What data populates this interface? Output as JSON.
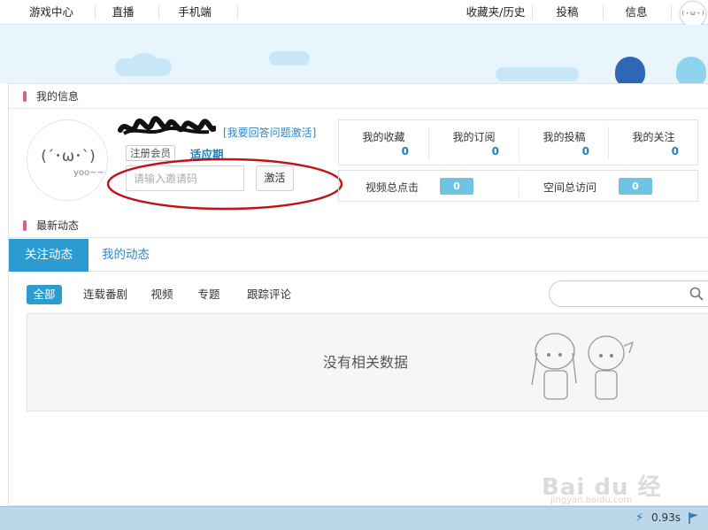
{
  "nav": {
    "game_center": "游戏中心",
    "live": "直播",
    "mobile": "手机端",
    "favorites": "收藏夹/历史",
    "submit": "投稿",
    "messages": "信息"
  },
  "profile_section": {
    "title": "我的信息"
  },
  "user": {
    "avatar_face": "(´･ω･`)",
    "avatar_caption": "yoo~~",
    "activate_link": "[我要回答问题激活]",
    "member_type": "注册会员",
    "status": "适应期",
    "invite_placeholder": "请输入邀请码",
    "activate_button": "激活"
  },
  "stats": {
    "favorites_label": "我的收藏",
    "favorites_value": "0",
    "subscriptions_label": "我的订阅",
    "subscriptions_value": "0",
    "submissions_label": "我的投稿",
    "submissions_value": "0",
    "following_label": "我的关注",
    "following_value": "0"
  },
  "totals": {
    "video_clicks_label": "视频总点击",
    "video_clicks_value": "0",
    "space_visits_label": "空间总访问",
    "space_visits_value": "0"
  },
  "feed_section": {
    "title": "最新动态"
  },
  "tabs": {
    "following": "关注动态",
    "mine": "我的动态"
  },
  "filters": {
    "all": "全部",
    "series": "连载番剧",
    "video": "视频",
    "topic": "专题",
    "comments": "跟踪评论"
  },
  "empty": {
    "message": "没有相关数据"
  },
  "watermark": {
    "text": "Bai du 经验",
    "url": "jingyan.baidu.com"
  },
  "statusbar": {
    "time": "0.93s"
  },
  "colors": {
    "accent": "#2c9bd0",
    "highlight_ring": "#c0141a",
    "pink_marker": "#e25b8a"
  }
}
